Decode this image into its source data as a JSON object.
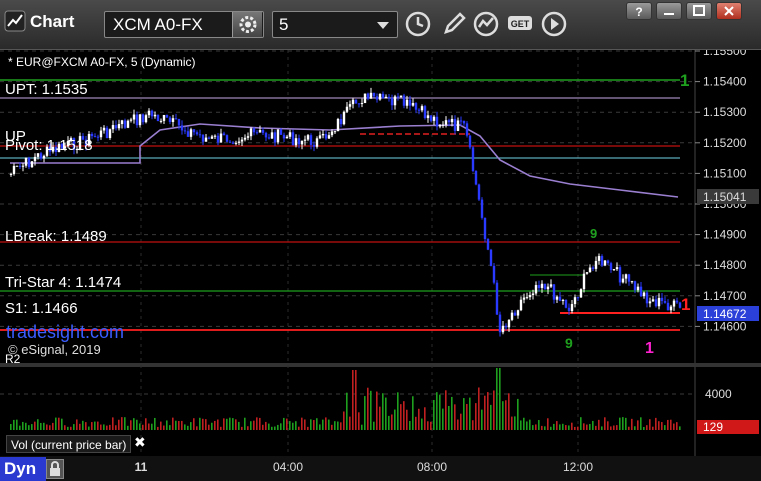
{
  "titlebar": {
    "title": "Chart",
    "symbol": "XCM A0-FX",
    "interval": "5",
    "window_buttons": [
      "help-icon",
      "minimize-icon",
      "maximize-icon",
      "close-icon"
    ]
  },
  "chart": {
    "header": "* EUR@FXCM A0-FX, 5 (Dynamic)",
    "watermark": "tradesight.com",
    "copyright": "© eSignal, 2019",
    "labels": {
      "upt": "UPT: 1.1535",
      "r1": "UP",
      "pivot": "Pivot: 1.1518",
      "lbreak": "LBreak: 1.1489",
      "tristar": "Tri-Star 4: 1.1474",
      "s1": "S1: 1.1466",
      "r2_partial": "R2"
    },
    "price_ticks": [
      "1.15500",
      "1.15400",
      "1.15300",
      "1.15200",
      "1.15100",
      "1.15000",
      "1.14900",
      "1.14800",
      "1.14700",
      "1.14600"
    ],
    "current_price": "1.14672",
    "ma_price": "1.15041",
    "time_ticks": [
      "11",
      "04:00",
      "08:00",
      "12:00"
    ],
    "annotations": [
      "1",
      "1",
      "9",
      "9",
      "1"
    ],
    "colors": {
      "upt": "#1ea01e",
      "pivot": "#c01010",
      "lbreak": "#c01010",
      "s1": "#ff2020",
      "ma": "#9a7fd0",
      "candle_up": "#ffffff",
      "candle_down": "#2a3aff",
      "current_price_bg": "#2a40d8"
    }
  },
  "volume": {
    "label": "Vol (current price bar)",
    "close": "✖",
    "tick": "4000",
    "current": "129",
    "current_bg": "#d01818"
  },
  "footer": {
    "dyn_label": "Dyn"
  }
}
